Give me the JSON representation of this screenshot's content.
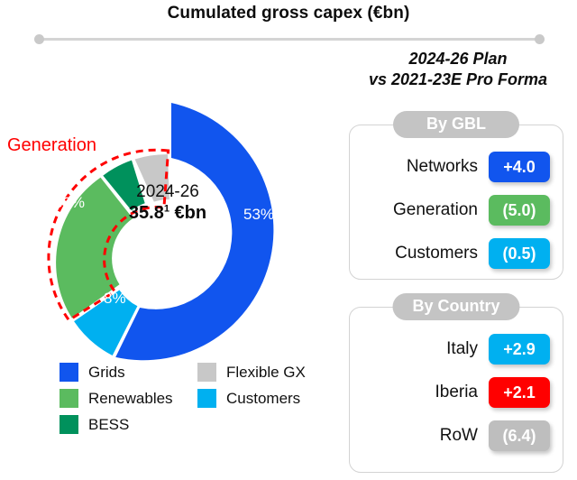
{
  "header": {
    "title": "Cumulated gross capex (€bn)",
    "divider_icon": "divider-line"
  },
  "donut": {
    "annotation_label": "Generation",
    "center_period": "2024-26",
    "center_value": "35.8",
    "center_value_superscript": "1",
    "center_unit": "€bn"
  },
  "legend": {
    "column1": [
      {
        "label": "Grids",
        "color": "#1155EE"
      },
      {
        "label": "Renewables",
        "color": "#5BBB5F"
      },
      {
        "label": "BESS",
        "color": "#00915C"
      }
    ],
    "column2": [
      {
        "label": "Flexible GX",
        "color": "#C8C8C8"
      },
      {
        "label": "Customers",
        "color": "#00B0F0"
      }
    ]
  },
  "right_panel": {
    "heading_line1": "2024-26 Plan",
    "heading_line2": "vs 2021-23E Pro Forma",
    "cards": [
      {
        "pill": "By GBL",
        "rows": [
          {
            "label": "Networks",
            "value": "+4.0",
            "color": "#1155EE"
          },
          {
            "label": "Generation",
            "value": "(5.0)",
            "color": "#5BBB5F"
          },
          {
            "label": "Customers",
            "value": "(0.5)",
            "color": "#00B0F0"
          }
        ]
      },
      {
        "pill": "By Country",
        "rows": [
          {
            "label": "Italy",
            "value": "+2.9",
            "color": "#00B0F0"
          },
          {
            "label": "Iberia",
            "value": "+2.1",
            "color": "#FF0000"
          },
          {
            "label": "RoW",
            "value": "(6.4)",
            "color": "#BEBEBE"
          }
        ]
      }
    ]
  },
  "chart_data": {
    "type": "pie",
    "title": "Cumulated gross capex (€bn)",
    "subtitle": "2024-26 35.8¹ €bn",
    "categories": [
      "Grids",
      "Customers",
      "Renewables",
      "BESS",
      "Flexible GX"
    ],
    "values": [
      53,
      8,
      30,
      4,
      5
    ],
    "value_labels": [
      "53%",
      "8%",
      "30%",
      "4%",
      "5%"
    ],
    "colors": [
      "#1155EE",
      "#00B0F0",
      "#5BBB5F",
      "#00915C",
      "#C8C8C8"
    ],
    "units": "percent of total",
    "total_label": "35.8¹ €bn",
    "annotations": [
      {
        "text": "Generation",
        "color": "#FF0000",
        "covers": [
          "Renewables",
          "BESS"
        ]
      }
    ],
    "legend_position": "bottom-left",
    "grid": false,
    "side_tables": [
      {
        "title": "By GBL",
        "subtitle": "2024-26 Plan vs 2021-23E Pro Forma",
        "rows": [
          {
            "label": "Networks",
            "value": "+4.0"
          },
          {
            "label": "Generation",
            "value": "(5.0)"
          },
          {
            "label": "Customers",
            "value": "(0.5)"
          }
        ]
      },
      {
        "title": "By Country",
        "subtitle": "2024-26 Plan vs 2021-23E Pro Forma",
        "rows": [
          {
            "label": "Italy",
            "value": "+2.9"
          },
          {
            "label": "Iberia",
            "value": "+2.1"
          },
          {
            "label": "RoW",
            "value": "(6.4)"
          }
        ]
      }
    ]
  }
}
